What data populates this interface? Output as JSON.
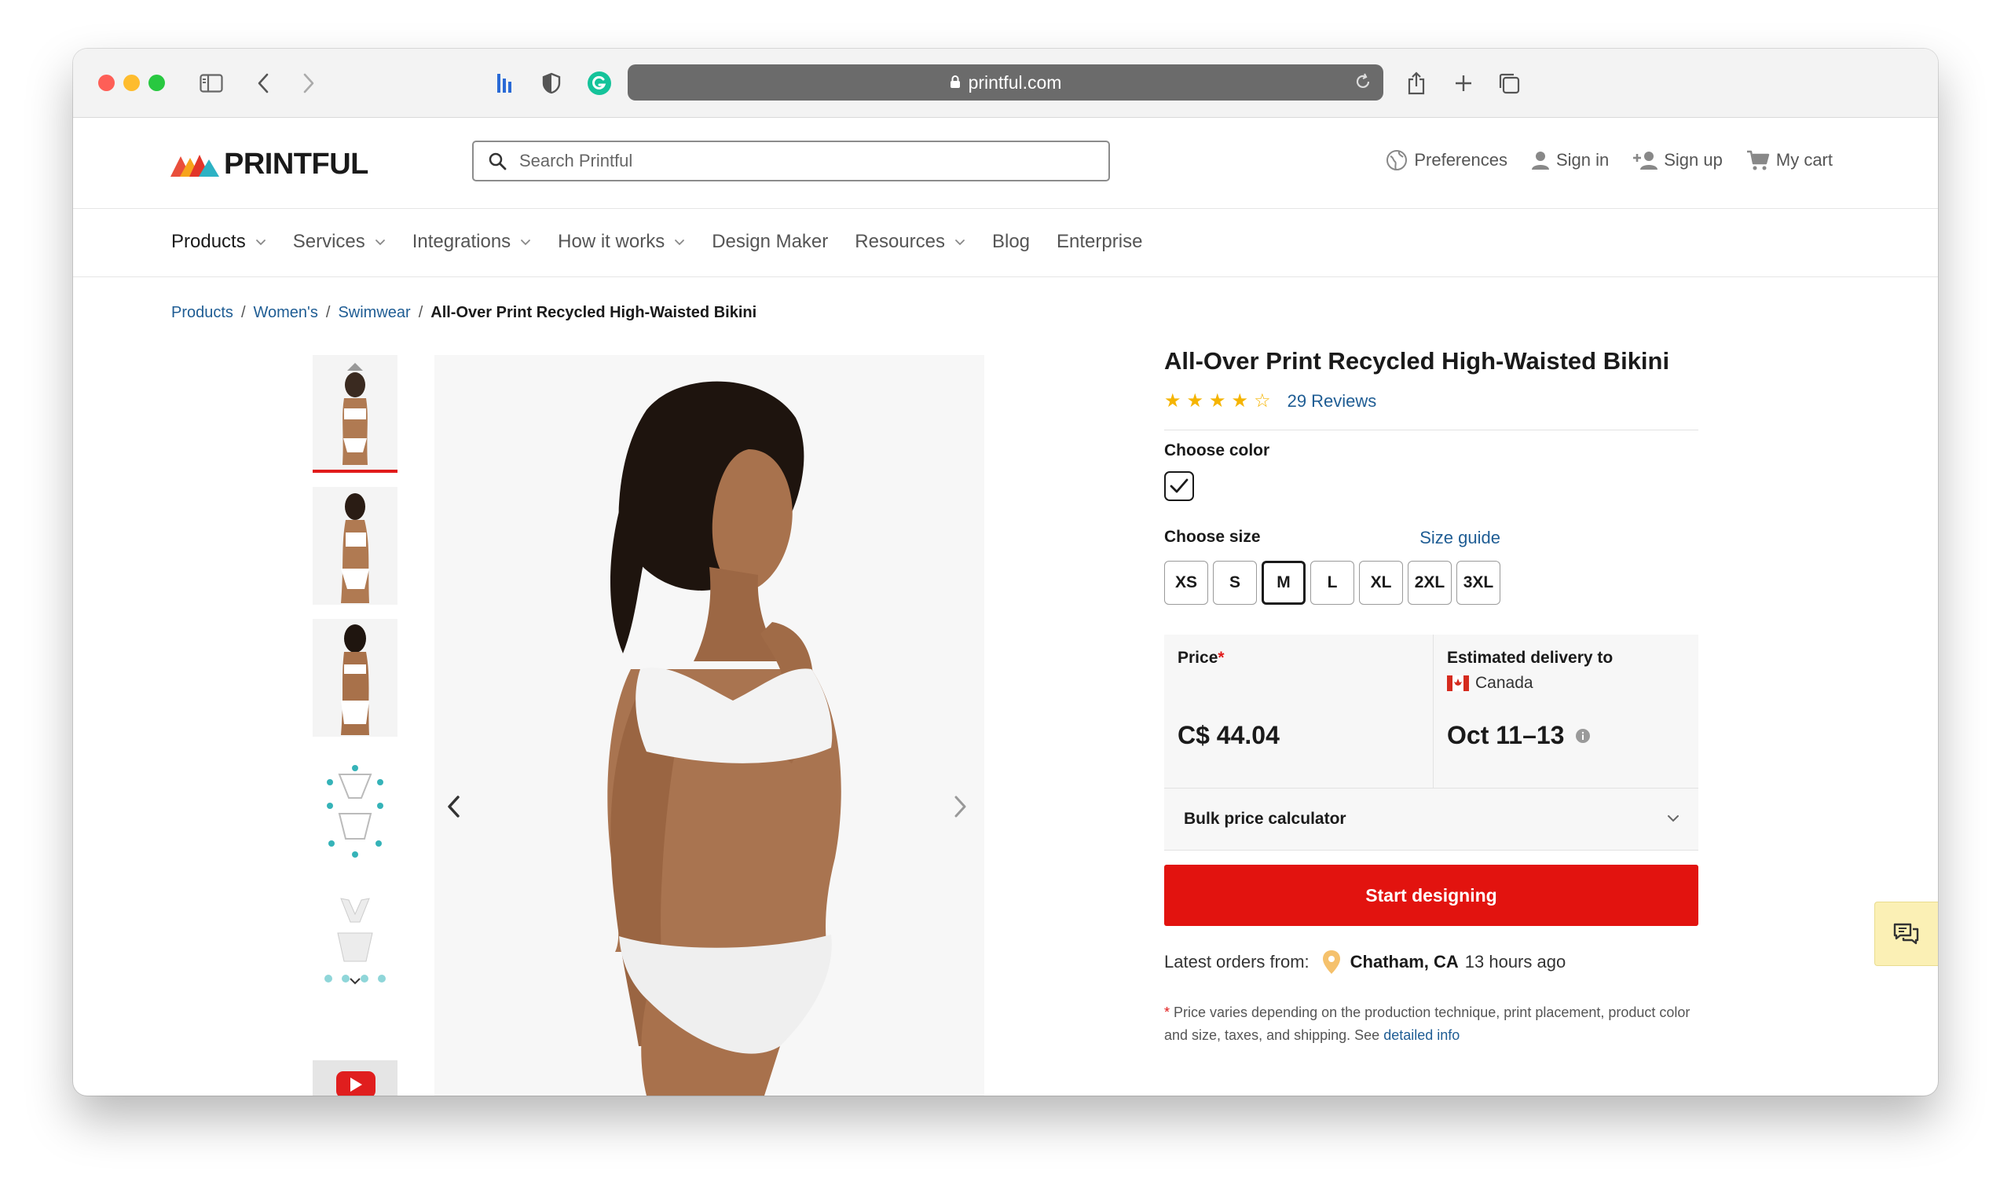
{
  "browser": {
    "url": "printful.com",
    "icons": [
      "sidebar-icon",
      "back-icon",
      "forward-icon",
      "extension-icon",
      "shield-icon",
      "grammarly-icon",
      "share-icon",
      "new-tab-icon",
      "tabs-icon"
    ]
  },
  "header": {
    "logo_text": "PRINTFUL",
    "search_placeholder": "Search Printful",
    "links": {
      "preferences": "Preferences",
      "sign_in": "Sign in",
      "sign_up": "Sign up",
      "cart": "My cart"
    }
  },
  "nav": {
    "items": [
      {
        "label": "Products",
        "dropdown": true
      },
      {
        "label": "Services",
        "dropdown": true
      },
      {
        "label": "Integrations",
        "dropdown": true
      },
      {
        "label": "How it works",
        "dropdown": true
      },
      {
        "label": "Design Maker",
        "dropdown": false
      },
      {
        "label": "Resources",
        "dropdown": true
      },
      {
        "label": "Blog",
        "dropdown": false
      },
      {
        "label": "Enterprise",
        "dropdown": false
      }
    ]
  },
  "breadcrumb": {
    "items": [
      "Products",
      "Women's",
      "Swimwear"
    ],
    "current": "All-Over Print Recycled High-Waisted Bikini"
  },
  "product": {
    "title": "All-Over Print Recycled High-Waisted Bikini",
    "rating_stars": 4,
    "rating_max": 5,
    "reviews": "29 Reviews",
    "choose_color_label": "Choose color",
    "choose_size_label": "Choose size",
    "size_guide": "Size guide",
    "sizes": [
      "XS",
      "S",
      "M",
      "L",
      "XL",
      "2XL",
      "3XL"
    ],
    "selected_size": "M",
    "price_label": "Price",
    "price_asterisk": "*",
    "price": "C$ 44.04",
    "delivery_label": "Estimated delivery to",
    "delivery_country": "Canada",
    "delivery_dates": "Oct 11–13",
    "bulk_label": "Bulk price calculator",
    "cta": "Start designing",
    "latest_label": "Latest orders from:",
    "latest_city": "Chatham, CA",
    "latest_time": "13 hours ago",
    "note_asterisk": "*",
    "note_text": " Price varies depending on the production technique, print placement, product color and size, taxes, and shipping. See ",
    "note_link": "detailed info"
  },
  "colors": {
    "accent_red": "#e2130f",
    "link_blue": "#1f5d94",
    "star_gold": "#f5b400",
    "chat_bg": "#fbf0b5"
  }
}
